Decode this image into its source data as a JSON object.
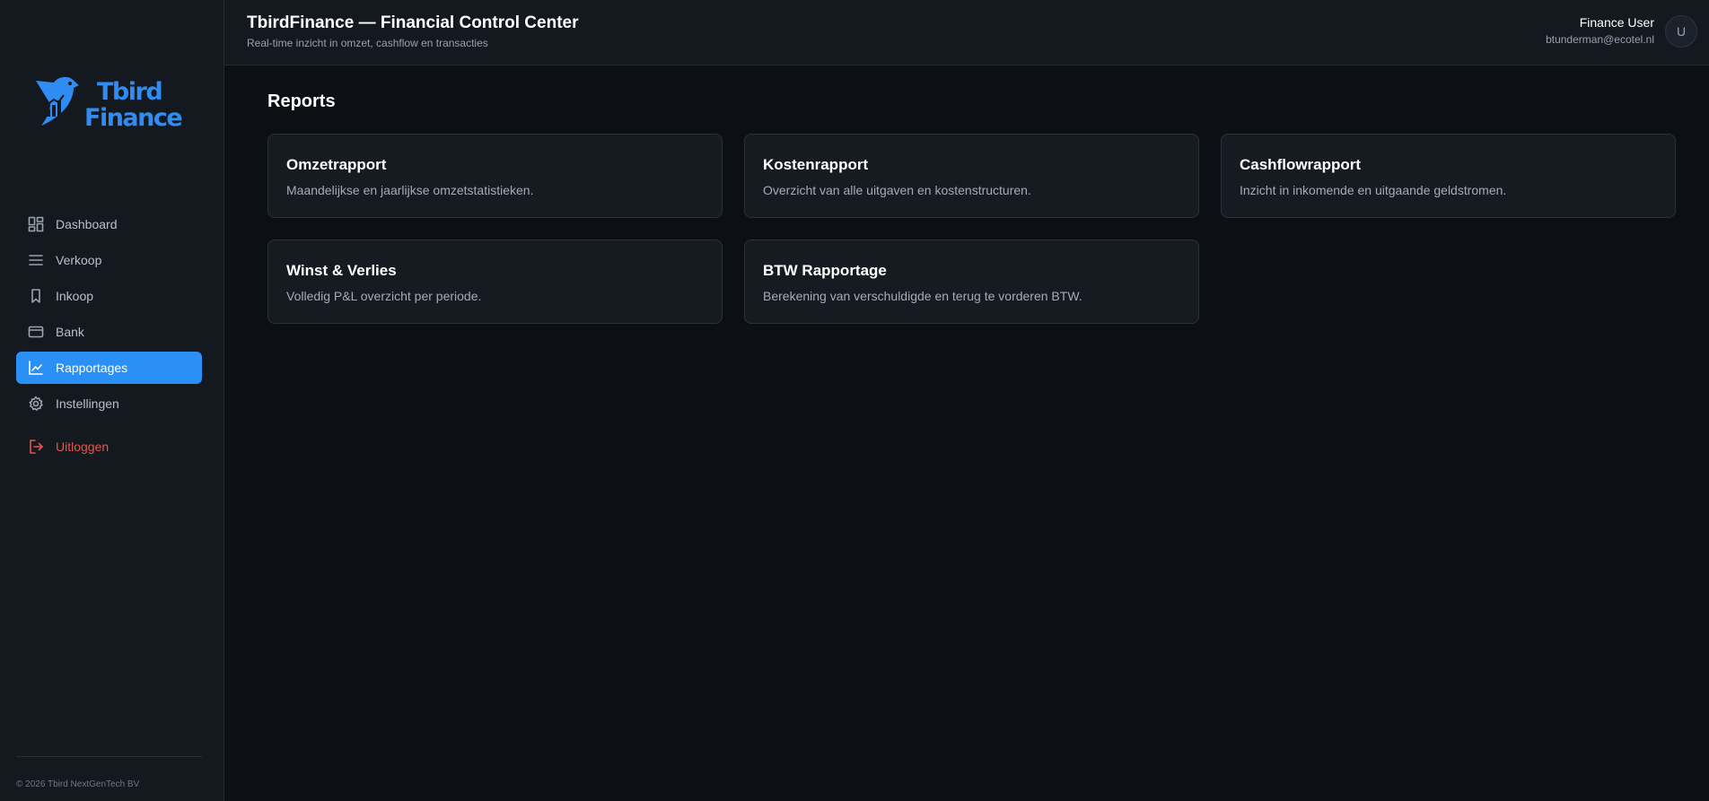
{
  "brand": {
    "logo_line1": "Tbird",
    "logo_line2": "Finance",
    "accent_color": "#2a90f5"
  },
  "sidebar": {
    "items": [
      {
        "label": "Dashboard",
        "icon": "dashboard-icon"
      },
      {
        "label": "Verkoop",
        "icon": "list-icon"
      },
      {
        "label": "Inkoop",
        "icon": "bookmark-icon"
      },
      {
        "label": "Bank",
        "icon": "credit-card-icon"
      },
      {
        "label": "Rapportages",
        "icon": "chart-line-icon",
        "active": true
      },
      {
        "label": "Instellingen",
        "icon": "gear-icon"
      }
    ],
    "logout_label": "Uitloggen",
    "copyright": "© 2026 Tbird NextGenTech BV"
  },
  "header": {
    "title": "TbirdFinance — Financial Control Center",
    "subtitle": "Real-time inzicht in omzet, cashflow en transacties",
    "user_name": "Finance User",
    "user_email": "btunderman@ecotel.nl",
    "avatar_initial": "U"
  },
  "main": {
    "page_title": "Reports",
    "cards": [
      {
        "title": "Omzetrapport",
        "description": "Maandelijkse en jaarlijkse omzetstatistieken."
      },
      {
        "title": "Kostenrapport",
        "description": "Overzicht van alle uitgaven en kostenstructuren."
      },
      {
        "title": "Cashflowrapport",
        "description": "Inzicht in inkomende en uitgaande geldstromen."
      },
      {
        "title": "Winst & Verlies",
        "description": "Volledig P&L overzicht per periode."
      },
      {
        "title": "BTW Rapportage",
        "description": "Berekening van verschuldigde en terug te vorderen BTW."
      }
    ]
  }
}
